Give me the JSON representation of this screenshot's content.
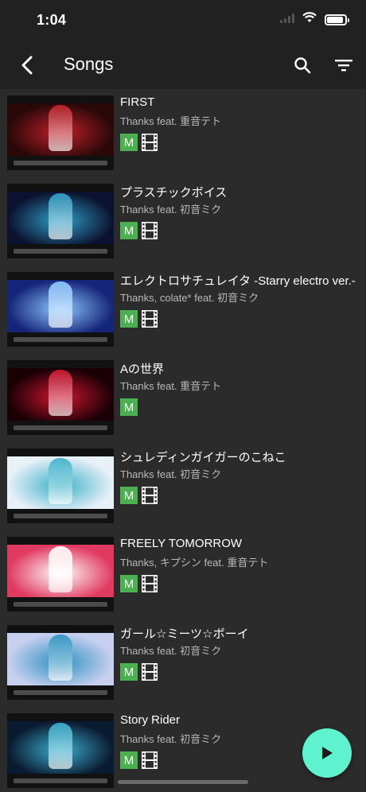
{
  "status": {
    "time": "1:04"
  },
  "header": {
    "title": "Songs",
    "back_icon": "back-arrow-icon",
    "search_icon": "search-icon",
    "filter_icon": "filter-icon"
  },
  "badge_m_label": "M",
  "songs": [
    {
      "title": "FIRST",
      "artist": "Thanks feat. 重音テト",
      "has_video": true,
      "thumb_colors": [
        "#2a0808",
        "#c0202a"
      ]
    },
    {
      "title": "プラスチックボイス",
      "artist": "Thanks feat. 初音ミク",
      "has_video": true,
      "thumb_colors": [
        "#0b1230",
        "#30a0c8"
      ]
    },
    {
      "title": "エレクトロサチュレイタ -Starry electro ver.-",
      "artist": "Thanks, colate* feat. 初音ミク",
      "has_video": true,
      "thumb_colors": [
        "#15257a",
        "#8fc8ff"
      ]
    },
    {
      "title": "Aの世界",
      "artist": "Thanks feat. 重音テト",
      "has_video": false,
      "thumb_colors": [
        "#1a0005",
        "#d01530"
      ]
    },
    {
      "title": "シュレディンガイガーのこねこ",
      "artist": "Thanks feat. 初音ミク",
      "has_video": true,
      "thumb_colors": [
        "#e8f0f8",
        "#3ab0c8"
      ]
    },
    {
      "title": "FREELY TOMORROW",
      "artist": "Thanks, キプシン feat. 重音テト",
      "has_video": true,
      "thumb_colors": [
        "#e03a60",
        "#ffffff"
      ]
    },
    {
      "title": "ガール☆ミーツ☆ボーイ",
      "artist": "Thanks feat. 初音ミク",
      "has_video": true,
      "thumb_colors": [
        "#c8d0f0",
        "#2a90c0"
      ]
    },
    {
      "title": "Story Rider",
      "artist": "Thanks feat. 初音ミク",
      "has_video": true,
      "thumb_colors": [
        "#0a1a30",
        "#3ab0d0"
      ]
    }
  ],
  "fab": {
    "icon": "play-icon"
  },
  "colors": {
    "app_bar": "#212121",
    "background": "#2b2b2b",
    "badge_green": "#4caf50",
    "fab": "#5ef2cf"
  }
}
